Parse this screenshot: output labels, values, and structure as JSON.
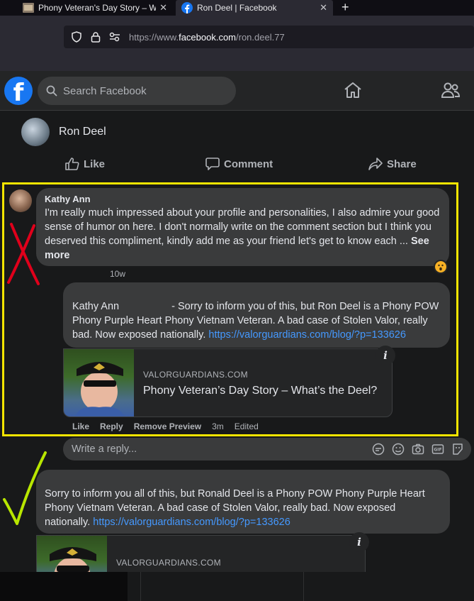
{
  "browser": {
    "tabs": [
      {
        "title": "Phony Veteran's Day Story – Wh",
        "icon": "site-favicon"
      },
      {
        "title": "Ron Deel | Facebook",
        "icon": "facebook-favicon",
        "active": true
      }
    ],
    "new_tab": "+",
    "url_prefix": "https://www.",
    "url_domain": "facebook.com",
    "url_path": "/ron.deel.77"
  },
  "facebook": {
    "logo": "f",
    "search_placeholder": "Search Facebook",
    "brand_color": "#1877f2"
  },
  "post": {
    "author": "Ron Deel",
    "actions": {
      "like": "Like",
      "comment": "Comment",
      "share": "Share"
    }
  },
  "comment1": {
    "author": "Kathy Ann",
    "text": "I'm really much impressed about your profile and personalities, I also admire your good sense of humor on here. I don't normally write on the comment section but I think you deserved this compliment, kindly add me as your friend let's get to know each ...",
    "see_more": "See more",
    "time": "10w",
    "reaction": "wow-reaction-icon"
  },
  "reply1": {
    "mention": "Kathy Ann",
    "text": " - Sorry to inform you of this, but Ron Deel is a Phony POW Phony Purple Heart Phony Vietnam Veteran. A bad case of Stolen Valor, really bad. Now exposed nationally. ",
    "link": "https://valorguardians.com/blog/?p=133626",
    "preview_domain": "VALORGUARDIANS.COM",
    "preview_title": "Phony Veteran’s Day Story – What’s the Deel?",
    "meta": {
      "like": "Like",
      "reply": "Reply",
      "remove_preview": "Remove Preview",
      "time": "3m",
      "edited": "Edited"
    }
  },
  "reply_box": {
    "placeholder": "Write a reply..."
  },
  "comment2": {
    "text": "Sorry to inform you all of this, but Ronald Deel is a Phony POW Phony Purple Heart Phony Vietnam Veteran. A bad case of Stolen Valor, really bad. Now exposed nationally. ",
    "link": "https://valorguardians.com/blog/?p=133626",
    "preview_domain": "VALORGUARDIANS.COM"
  },
  "colors": {
    "highlight": "#f5e500",
    "cross_mark": "#e0001b",
    "check_mark": "#b8e600",
    "link": "#4599ff"
  }
}
